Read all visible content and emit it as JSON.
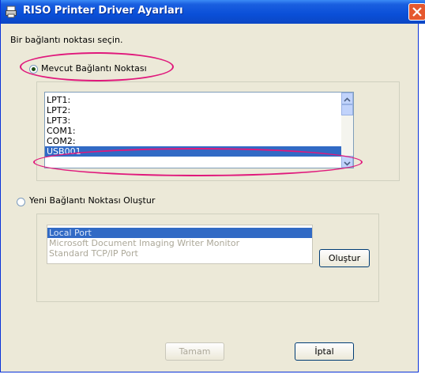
{
  "window": {
    "title": "RISO Printer Driver Ayarları"
  },
  "prompt": "Bir bağlantı noktası seçin.",
  "existing_port": {
    "label": "Mevcut Bağlantı Noktası",
    "selected": true,
    "ports": [
      "LPT1:",
      "LPT2:",
      "LPT3:",
      "COM1:",
      "COM2:",
      "USB001"
    ],
    "selected_port": "USB001"
  },
  "new_port": {
    "label": "Yeni Bağlantı Noktası Oluştur",
    "selected": false,
    "types": [
      "Local Port",
      "Microsoft Document Imaging Writer Monitor",
      "Standard TCP/IP Port"
    ],
    "create_button": "Oluştur"
  },
  "buttons": {
    "ok": "Tamam",
    "cancel": "İptal"
  },
  "colors": {
    "titlebar": "#0a4fd8",
    "dialog_bg": "#ece9d8",
    "selection": "#316ac5",
    "annotation": "#e0197c"
  }
}
